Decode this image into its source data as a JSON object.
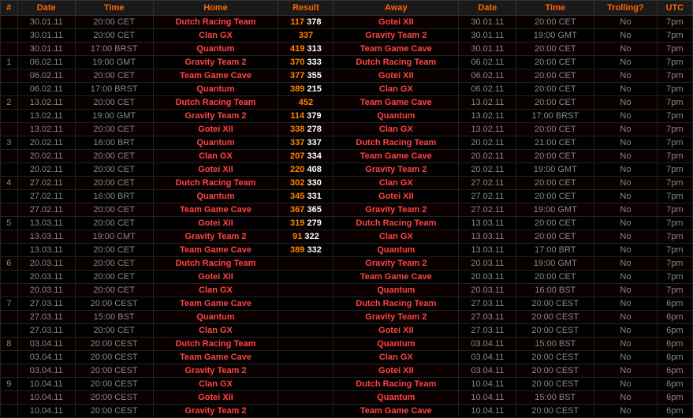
{
  "header": {
    "cols": [
      "#",
      "Date",
      "Time",
      "Home",
      "Result",
      "Away",
      "Date",
      "Time",
      "Trolling?",
      "UTC"
    ]
  },
  "rows": [
    {
      "num": "",
      "date1": "30.01.11",
      "time1": "20:00 CET",
      "home": "Dutch Racing Team",
      "res_h": "117",
      "res_a": "378",
      "away": "Gotei XII",
      "date2": "30.01.11",
      "time2": "20:00 CET",
      "trolling": "No",
      "utc": "7pm"
    },
    {
      "num": "",
      "date1": "30.01.11",
      "time1": "20:00 CET",
      "home": "Clan GX",
      "res_h": "337",
      "res_a": "",
      "away": "Gravity Team 2",
      "date2": "30.01.11",
      "time2": "19:00 GMT",
      "trolling": "No",
      "utc": "7pm"
    },
    {
      "num": "",
      "date1": "30.01.11",
      "time1": "17:00 BRST",
      "home": "Quantum",
      "res_h": "419",
      "res_a": "313",
      "away": "Team Game Cave",
      "date2": "30.01.11",
      "time2": "20:00 CET",
      "trolling": "No",
      "utc": "7pm"
    },
    {
      "num": "1",
      "date1": "06.02.11",
      "time1": "19:00 GMT",
      "home": "Gravity Team 2",
      "res_h": "370",
      "res_a": "333",
      "away": "Dutch Racing Team",
      "date2": "06.02.11",
      "time2": "20:00 CET",
      "trolling": "No",
      "utc": "7pm"
    },
    {
      "num": "",
      "date1": "06.02.11",
      "time1": "20:00 CET",
      "home": "Team Game Cave",
      "res_h": "377",
      "res_a": "355",
      "away": "Gotei XII",
      "date2": "06.02.11",
      "time2": "20:00 CET",
      "trolling": "No",
      "utc": "7pm"
    },
    {
      "num": "",
      "date1": "06.02.11",
      "time1": "17:00 BRST",
      "home": "Quantum",
      "res_h": "389",
      "res_a": "215",
      "away": "Clan GX",
      "date2": "06.02.11",
      "time2": "20:00 CET",
      "trolling": "No",
      "utc": "7pm"
    },
    {
      "num": "2",
      "date1": "13.02.11",
      "time1": "20:00 CET",
      "home": "Dutch Racing Team",
      "res_h": "452",
      "res_a": "",
      "away": "Team Game Cave",
      "date2": "13.02.11",
      "time2": "20:00 CET",
      "trolling": "No",
      "utc": "7pm"
    },
    {
      "num": "",
      "date1": "13.02.11",
      "time1": "19:00 GMT",
      "home": "Gravity Team 2",
      "res_h": "114",
      "res_a": "379",
      "away": "Quantum",
      "date2": "13.02.11",
      "time2": "17:00 BRST",
      "trolling": "No",
      "utc": "7pm"
    },
    {
      "num": "",
      "date1": "13.02.11",
      "time1": "20:00 CET",
      "home": "Gotei XII",
      "res_h": "338",
      "res_a": "278",
      "away": "Clan GX",
      "date2": "13.02.11",
      "time2": "20:00 CET",
      "trolling": "No",
      "utc": "7pm"
    },
    {
      "num": "3",
      "date1": "20.02.11",
      "time1": "16:00 BRT",
      "home": "Quantum",
      "res_h": "337",
      "res_a": "337",
      "away": "Dutch Racing Team",
      "date2": "20.02.11",
      "time2": "21:00 CET",
      "trolling": "No",
      "utc": "7pm"
    },
    {
      "num": "",
      "date1": "20.02.11",
      "time1": "20:00 CET",
      "home": "Clan GX",
      "res_h": "207",
      "res_a": "334",
      "away": "Team Game Cave",
      "date2": "20.02.11",
      "time2": "20:00 CET",
      "trolling": "No",
      "utc": "7pm"
    },
    {
      "num": "",
      "date1": "20.02.11",
      "time1": "20:00 CET",
      "home": "Gotei XII",
      "res_h": "220",
      "res_a": "408",
      "away": "Gravity Team 2",
      "date2": "20.02.11",
      "time2": "19:00 GMT",
      "trolling": "No",
      "utc": "7pm"
    },
    {
      "num": "4",
      "date1": "27.02.11",
      "time1": "20:00 CET",
      "home": "Dutch Racing Team",
      "res_h": "302",
      "res_a": "330",
      "away": "Clan GX",
      "date2": "27.02.11",
      "time2": "20:00 CET",
      "trolling": "No",
      "utc": "7pm"
    },
    {
      "num": "",
      "date1": "27.02.11",
      "time1": "16:00 BRT",
      "home": "Quantum",
      "res_h": "345",
      "res_a": "331",
      "away": "Gotei XII",
      "date2": "27.02.11",
      "time2": "20:00 CET",
      "trolling": "No",
      "utc": "7pm"
    },
    {
      "num": "",
      "date1": "27.02.11",
      "time1": "20:00 CET",
      "home": "Team Game Cave",
      "res_h": "367",
      "res_a": "365",
      "away": "Gravity Team 2",
      "date2": "27.02.11",
      "time2": "19:00 GMT",
      "trolling": "No",
      "utc": "7pm"
    },
    {
      "num": "5",
      "date1": "13.03.11",
      "time1": "20:00 CET",
      "home": "Gotei XII",
      "res_h": "319",
      "res_a": "279",
      "away": "Dutch Racing Team",
      "date2": "13.03.11",
      "time2": "20:00 CET",
      "trolling": "No",
      "utc": "7pm"
    },
    {
      "num": "",
      "date1": "13.03.11",
      "time1": "19:00 CMT",
      "home": "Gravity Team 2",
      "res_h": "91",
      "res_a": "322",
      "away": "Clan GX",
      "date2": "13.03.11",
      "time2": "20:00 CET",
      "trolling": "No",
      "utc": "7pm"
    },
    {
      "num": "",
      "date1": "13.03.11",
      "time1": "20:00 CET",
      "home": "Team Game Cave",
      "res_h": "389",
      "res_a": "332",
      "away": "Quantum",
      "date2": "13.03.11",
      "time2": "17:00 BRT",
      "trolling": "No",
      "utc": "7pm"
    },
    {
      "num": "6",
      "date1": "20.03.11",
      "time1": "20:00 CET",
      "home": "Dutch Racing Team",
      "res_h": "",
      "res_a": "",
      "away": "Gravity Team 2",
      "date2": "20.03.11",
      "time2": "19:00 GMT",
      "trolling": "No",
      "utc": "7pm"
    },
    {
      "num": "",
      "date1": "20.03.11",
      "time1": "20:00 CET",
      "home": "Gotei XII",
      "res_h": "",
      "res_a": "",
      "away": "Team Game Cave",
      "date2": "20.03.11",
      "time2": "20:00 CET",
      "trolling": "No",
      "utc": "7pm"
    },
    {
      "num": "",
      "date1": "20.03.11",
      "time1": "20:00 CET",
      "home": "Clan GX",
      "res_h": "",
      "res_a": "",
      "away": "Quantum",
      "date2": "20.03.11",
      "time2": "16:00 BST",
      "trolling": "No",
      "utc": "7pm"
    },
    {
      "num": "7",
      "date1": "27.03.11",
      "time1": "20:00 CEST",
      "home": "Team Game Cave",
      "res_h": "",
      "res_a": "",
      "away": "Dutch Racing Team",
      "date2": "27.03.11",
      "time2": "20:00 CEST",
      "trolling": "No",
      "utc": "6pm"
    },
    {
      "num": "",
      "date1": "27.03.11",
      "time1": "15:00 BST",
      "home": "Quantum",
      "res_h": "",
      "res_a": "",
      "away": "Gravity Team 2",
      "date2": "27.03.11",
      "time2": "20:00 CEST",
      "trolling": "No",
      "utc": "6pm"
    },
    {
      "num": "",
      "date1": "27.03.11",
      "time1": "20:00 CET",
      "home": "Clan GX",
      "res_h": "",
      "res_a": "",
      "away": "Gotei XII",
      "date2": "27.03.11",
      "time2": "20:00 CEST",
      "trolling": "No",
      "utc": "6pm"
    },
    {
      "num": "8",
      "date1": "03.04.11",
      "time1": "20:00 CEST",
      "home": "Dutch Racing Team",
      "res_h": "",
      "res_a": "",
      "away": "Quantum",
      "date2": "03.04.11",
      "time2": "15:00 BST",
      "trolling": "No",
      "utc": "6pm"
    },
    {
      "num": "",
      "date1": "03.04.11",
      "time1": "20:00 CEST",
      "home": "Team Game Cave",
      "res_h": "",
      "res_a": "",
      "away": "Clan GX",
      "date2": "03.04.11",
      "time2": "20:00 CEST",
      "trolling": "No",
      "utc": "6pm"
    },
    {
      "num": "",
      "date1": "03.04.11",
      "time1": "20:00 CEST",
      "home": "Gravity Team 2",
      "res_h": "",
      "res_a": "",
      "away": "Gotei XII",
      "date2": "03.04.11",
      "time2": "20:00 CEST",
      "trolling": "No",
      "utc": "6pm"
    },
    {
      "num": "9",
      "date1": "10.04.11",
      "time1": "20:00 CEST",
      "home": "Clan GX",
      "res_h": "",
      "res_a": "",
      "away": "Dutch Racing Team",
      "date2": "10.04.11",
      "time2": "20:00 CEST",
      "trolling": "No",
      "utc": "6pm"
    },
    {
      "num": "",
      "date1": "10.04.11",
      "time1": "20:00 CEST",
      "home": "Gotei XII",
      "res_h": "",
      "res_a": "",
      "away": "Quantum",
      "date2": "10.04.11",
      "time2": "15:00 BST",
      "trolling": "No",
      "utc": "6pm"
    },
    {
      "num": "",
      "date1": "10.04.11",
      "time1": "20:00 CEST",
      "home": "Gravity Team 2",
      "res_h": "",
      "res_a": "",
      "away": "Team Game Cave",
      "date2": "10.04.11",
      "time2": "20:00 CEST",
      "trolling": "No",
      "utc": "6pm"
    }
  ]
}
